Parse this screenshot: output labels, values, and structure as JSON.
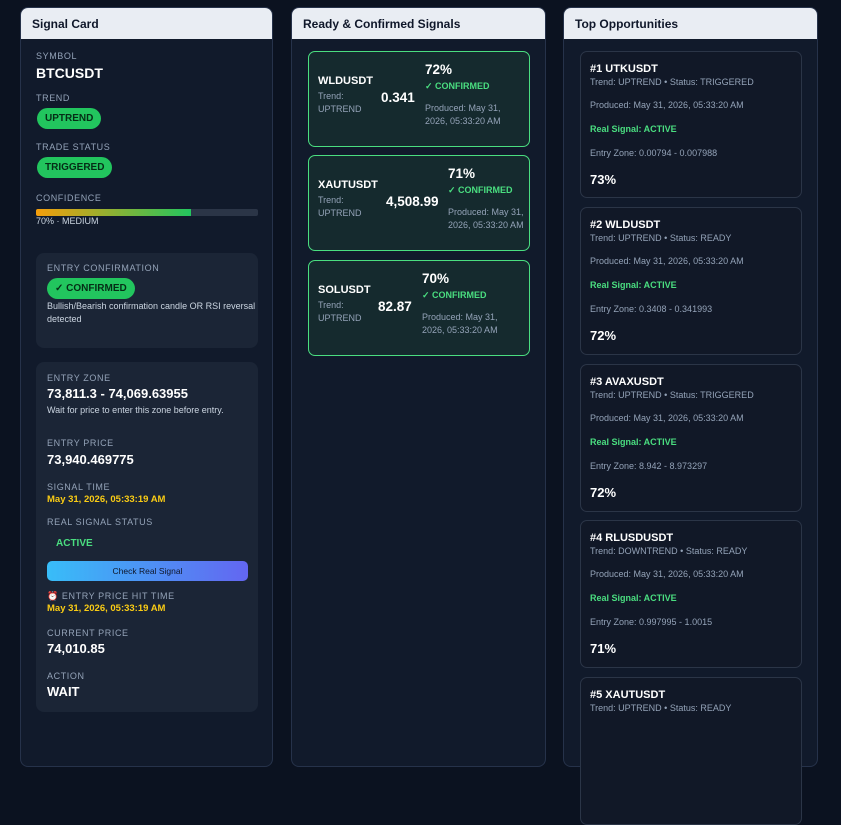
{
  "signal_card": {
    "title": "Signal Card",
    "symbol_label": "SYMBOL",
    "symbol": "BTCUSDT",
    "trend_label": "TREND",
    "trend": "UPTREND",
    "trade_status_label": "TRADE STATUS",
    "trade_status": "TRIGGERED",
    "confidence_label": "CONFIDENCE",
    "confidence_value": 0.7,
    "confidence_text": "70% · MEDIUM",
    "entry_confirmation": {
      "label": "ENTRY CONFIRMATION",
      "badge": "✓ CONFIRMED",
      "note": "Bullish/Bearish confirmation candle OR RSI reversal detected"
    },
    "entry_zone_label": "ENTRY ZONE",
    "entry_zone": "73,811.3 - 74,069.63955",
    "entry_zone_note": "Wait for price to enter this zone before entry.",
    "entry_price_label": "ENTRY PRICE",
    "entry_price": "73,940.469775",
    "signal_time_label": "SIGNAL TIME",
    "signal_time": "May 31, 2026, 05:33:19 AM",
    "real_signal_status_label": "REAL SIGNAL STATUS",
    "real_signal_status": "ACTIVE",
    "check_button": "Check Real Signal",
    "hit_time_label": "⏰ ENTRY PRICE HIT TIME",
    "hit_time": "May 31, 2026, 05:33:19 AM",
    "current_price_label": "CURRENT PRICE",
    "current_price": "74,010.85",
    "action_label": "ACTION",
    "action": "WAIT"
  },
  "ready_signals": {
    "title": "Ready & Confirmed Signals",
    "items": [
      {
        "symbol": "WLDUSDT",
        "trend": "Trend: UPTREND",
        "price": "0.341",
        "confidence": "72%",
        "status": "✓ CONFIRMED",
        "produced": "Produced: May 31, 2026, 05:33:20 AM"
      },
      {
        "symbol": "XAUTUSDT",
        "trend": "Trend: UPTREND",
        "price": "4,508.99",
        "confidence": "71%",
        "status": "✓ CONFIRMED",
        "produced": "Produced: May 31, 2026, 05:33:20 AM"
      },
      {
        "symbol": "SOLUSDT",
        "trend": "Trend: UPTREND",
        "price": "82.87",
        "confidence": "70%",
        "status": "✓ CONFIRMED",
        "produced": "Produced: May 31, 2026, 05:33:20 AM"
      }
    ]
  },
  "top_opportunities": {
    "title": "Top Opportunities",
    "items": [
      {
        "title": "#1 UTKUSDT",
        "status": "Trend: UPTREND • Status: TRIGGERED",
        "produced": "Produced: May 31, 2026, 05:33:20 AM",
        "real": "Real Signal: ACTIVE",
        "zone": "Entry Zone: 0.00794 - 0.007988",
        "confidence": "73%"
      },
      {
        "title": "#2 WLDUSDT",
        "status": "Trend: UPTREND • Status: READY",
        "produced": "Produced: May 31, 2026, 05:33:20 AM",
        "real": "Real Signal: ACTIVE",
        "zone": "Entry Zone: 0.3408 - 0.341993",
        "confidence": "72%"
      },
      {
        "title": "#3 AVAXUSDT",
        "status": "Trend: UPTREND • Status: TRIGGERED",
        "produced": "Produced: May 31, 2026, 05:33:20 AM",
        "real": "Real Signal: ACTIVE",
        "zone": "Entry Zone: 8.942 - 8.973297",
        "confidence": "72%"
      },
      {
        "title": "#4 RLUSDUSDT",
        "status": "Trend: DOWNTREND • Status: READY",
        "produced": "Produced: May 31, 2026, 05:33:20 AM",
        "real": "Real Signal: ACTIVE",
        "zone": "Entry Zone: 0.997995 - 1.0015",
        "confidence": "71%"
      },
      {
        "title": "#5 XAUTUSDT",
        "status": "Trend: UPTREND • Status: READY",
        "produced": "",
        "real": "",
        "zone": "",
        "confidence": ""
      }
    ]
  },
  "colors": {
    "accent_green": "#22c55e",
    "confirmed_green": "#4ade80",
    "highlight_yellow": "#facc15",
    "background": "#0b1220"
  }
}
